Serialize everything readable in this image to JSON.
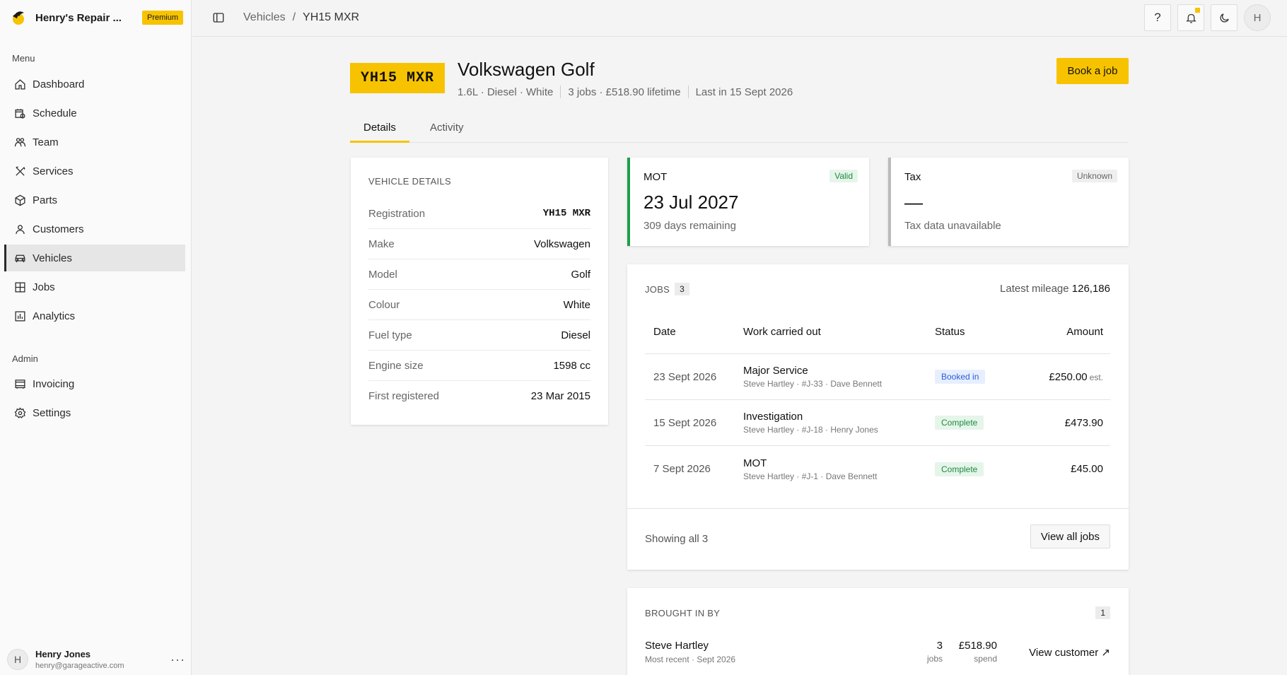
{
  "sidebar": {
    "brand": "Henry's Repair ...",
    "premium": "Premium",
    "menu_label": "Menu",
    "admin_label": "Admin",
    "menu": [
      {
        "label": "Dashboard",
        "icon": "home-icon"
      },
      {
        "label": "Schedule",
        "icon": "calendar-clock-icon"
      },
      {
        "label": "Team",
        "icon": "team-icon"
      },
      {
        "label": "Services",
        "icon": "tools-icon"
      },
      {
        "label": "Parts",
        "icon": "package-icon"
      },
      {
        "label": "Customers",
        "icon": "user-icon"
      },
      {
        "label": "Vehicles",
        "icon": "car-icon",
        "active": true
      },
      {
        "label": "Jobs",
        "icon": "grid-icon"
      },
      {
        "label": "Analytics",
        "icon": "chart-icon"
      }
    ],
    "admin": [
      {
        "label": "Invoicing",
        "icon": "invoice-icon"
      },
      {
        "label": "Settings",
        "icon": "gear-icon"
      }
    ],
    "user": {
      "initial": "H",
      "name": "Henry Jones",
      "email": "henry@garageactive.com",
      "more": "···"
    }
  },
  "topbar": {
    "breadcrumb": [
      "Vehicles",
      "/",
      "YH15 MXR"
    ],
    "help": "?",
    "avatar": "H"
  },
  "header": {
    "plate": "YH15 MXR",
    "title": "Volkswagen Golf",
    "meta": [
      "1.6L · Diesel · White",
      "3 jobs · £518.90 lifetime",
      "Last in 15 Sept 2026"
    ],
    "book_button": "Book a job"
  },
  "tabs": [
    "Details",
    "Activity"
  ],
  "vehicle_details": {
    "label": "VEHICLE DETAILS",
    "rows": [
      {
        "key": "Registration",
        "value": "YH15 MXR"
      },
      {
        "key": "Make",
        "value": "Volkswagen"
      },
      {
        "key": "Model",
        "value": "Golf"
      },
      {
        "key": "Colour",
        "value": "White"
      },
      {
        "key": "Fuel type",
        "value": "Diesel"
      },
      {
        "key": "Engine size",
        "value": "1598 cc"
      },
      {
        "key": "First registered",
        "value": "23 Mar 2015"
      }
    ]
  },
  "mot": {
    "title": "MOT",
    "badge": "Valid",
    "date": "23 Jul 2027",
    "sub": "309 days remaining",
    "color": "#1e9e4a"
  },
  "tax": {
    "title": "Tax",
    "badge": "Unknown",
    "value": "—",
    "sub": "Tax data unavailable"
  },
  "jobs": {
    "label": "JOBS",
    "count": "3",
    "mileage_label": "Latest mileage",
    "mileage": "126,186",
    "headers": [
      "Date",
      "Work carried out",
      "Status",
      "Amount"
    ],
    "rows": [
      {
        "date": "23 Sept 2026",
        "work": "Major Service",
        "sub": "Steve Hartley · #J-33 · Dave Bennett",
        "status": "Booked in",
        "amount": "£250.00",
        "note": "est."
      },
      {
        "date": "15 Sept 2026",
        "work": "Investigation",
        "sub": "Steve Hartley · #J-18 · Henry Jones",
        "status": "Complete",
        "amount": "£473.90",
        "note": ""
      },
      {
        "date": "7 Sept 2026",
        "work": "MOT",
        "sub": "Steve Hartley · #J-1 · Dave Bennett",
        "status": "Complete",
        "amount": "£45.00",
        "note": ""
      }
    ],
    "showing": "Showing all 3",
    "view_all": "View all jobs"
  },
  "brought_in": {
    "label": "BROUGHT IN BY",
    "count": "1",
    "name": "Steve Hartley",
    "sub": "Most recent · Sept 2026",
    "jobs_val": "3",
    "jobs_lab": "jobs",
    "spend_val": "£518.90",
    "spend_lab": "spend",
    "link": "View customer ↗"
  },
  "colors": {
    "accent": "#f7c300",
    "valid": "#1e9e4a",
    "booked": "#2b5bd7"
  }
}
